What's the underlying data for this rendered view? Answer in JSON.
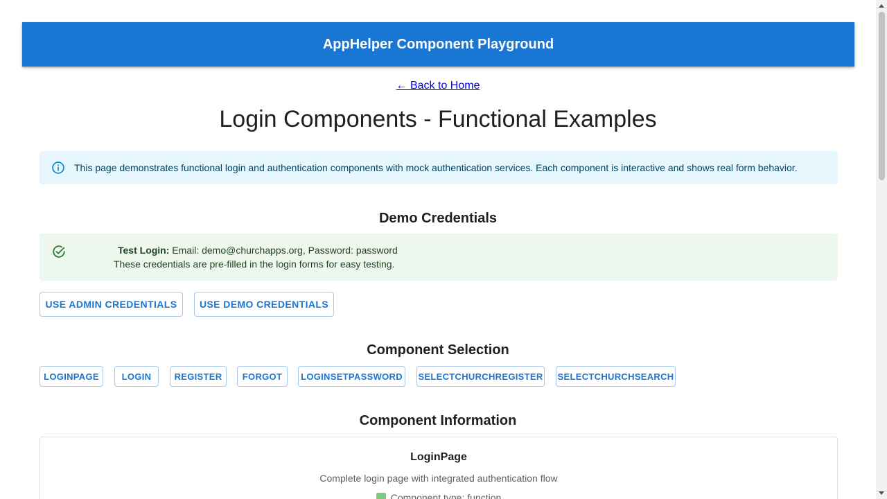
{
  "appbar": {
    "title": "AppHelper Component Playground"
  },
  "nav": {
    "back_link": "← Back to Home"
  },
  "page": {
    "title": "Login Components - Functional Examples"
  },
  "info_alert": {
    "icon": "info-icon",
    "text": "This page demonstrates functional login and authentication components with mock authentication services. Each component is interactive and shows real form behavior."
  },
  "credentials": {
    "heading": "Demo Credentials",
    "alert_icon": "check-circle-icon",
    "label": "Test Login:",
    "details": "Email: demo@churchapps.org, Password: password",
    "note": "These credentials are pre-filled in the login forms for easy testing.",
    "buttons": {
      "admin": "USE ADMIN CREDENTIALS",
      "demo": "USE DEMO CREDENTIALS"
    }
  },
  "selection": {
    "heading": "Component Selection",
    "components": [
      "LOGINPAGE",
      "LOGIN",
      "REGISTER",
      "FORGOT",
      "LOGINSETPASSWORD",
      "SELECTCHURCHREGISTER",
      "SELECTCHURCHSEARCH"
    ]
  },
  "information": {
    "heading": "Component Information",
    "name": "LoginPage",
    "description": "Complete login page with integrated authentication flow",
    "type_text": "Component type: function"
  },
  "colors": {
    "primary": "#1976d2",
    "info_bg": "#e5f6fd",
    "success_bg": "#edf7ed",
    "success_icon": "#2e7d32"
  }
}
